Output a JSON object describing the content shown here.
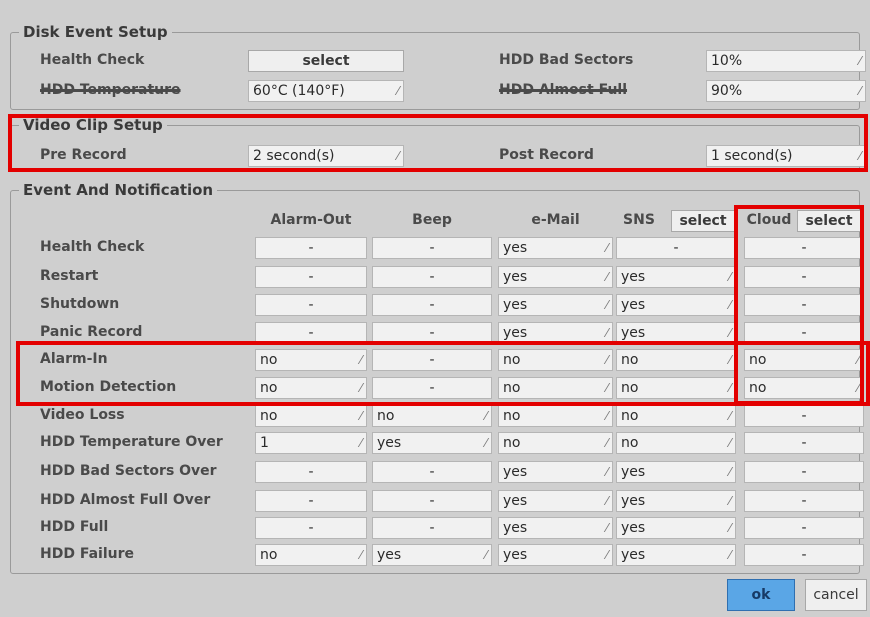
{
  "disk": {
    "title": "Disk Event Setup",
    "health_label": "Health Check",
    "health_btn": "select",
    "temp_label": "HDD Temperature",
    "temp_value": "60°C (140°F)",
    "bad_label": "HDD Bad Sectors",
    "bad_value": "10%",
    "almost_label": "HDD Almost Full",
    "almost_value": "90%"
  },
  "video": {
    "title": "Video Clip Setup",
    "pre_label": "Pre Record",
    "pre_value": "2 second(s)",
    "post_label": "Post Record",
    "post_value": "1 second(s)"
  },
  "event": {
    "title": "Event And Notification",
    "col_alarm": "Alarm-Out",
    "col_beep": "Beep",
    "col_email": "e-Mail",
    "col_sns": "SNS",
    "sns_select": "select",
    "col_cloud": "Cloud",
    "cloud_select": "select",
    "rows": [
      {
        "label": "Health Check",
        "alarm": "-",
        "beep": "-",
        "email": "yes",
        "sns": "-",
        "cloud": "-"
      },
      {
        "label": "Restart",
        "alarm": "-",
        "beep": "-",
        "email": "yes",
        "sns": "yes",
        "cloud": "-"
      },
      {
        "label": "Shutdown",
        "alarm": "-",
        "beep": "-",
        "email": "yes",
        "sns": "yes",
        "cloud": "-"
      },
      {
        "label": "Panic Record",
        "alarm": "-",
        "beep": "-",
        "email": "yes",
        "sns": "yes",
        "cloud": "-"
      },
      {
        "label": "Alarm-In",
        "alarm": "no",
        "beep": "-",
        "email": "no",
        "sns": "no",
        "cloud": "no"
      },
      {
        "label": "Motion Detection",
        "alarm": "no",
        "beep": "-",
        "email": "no",
        "sns": "no",
        "cloud": "no"
      },
      {
        "label": "Video Loss",
        "alarm": "no",
        "beep": "no",
        "email": "no",
        "sns": "no",
        "cloud": "-"
      },
      {
        "label": "HDD Temperature Over",
        "alarm": "1",
        "beep": "yes",
        "email": "no",
        "sns": "no",
        "cloud": "-"
      },
      {
        "label": "HDD Bad Sectors Over",
        "alarm": "-",
        "beep": "-",
        "email": "yes",
        "sns": "yes",
        "cloud": "-"
      },
      {
        "label": "HDD Almost Full Over",
        "alarm": "-",
        "beep": "-",
        "email": "yes",
        "sns": "yes",
        "cloud": "-"
      },
      {
        "label": "HDD Full",
        "alarm": "-",
        "beep": "-",
        "email": "yes",
        "sns": "yes",
        "cloud": "-"
      },
      {
        "label": "HDD Failure",
        "alarm": "no",
        "beep": "yes",
        "email": "yes",
        "sns": "yes",
        "cloud": "-"
      }
    ]
  },
  "footer": {
    "ok": "ok",
    "cancel": "cancel"
  },
  "colors": {
    "highlight": "#e30000",
    "ok_button": "#5aa6e6"
  }
}
